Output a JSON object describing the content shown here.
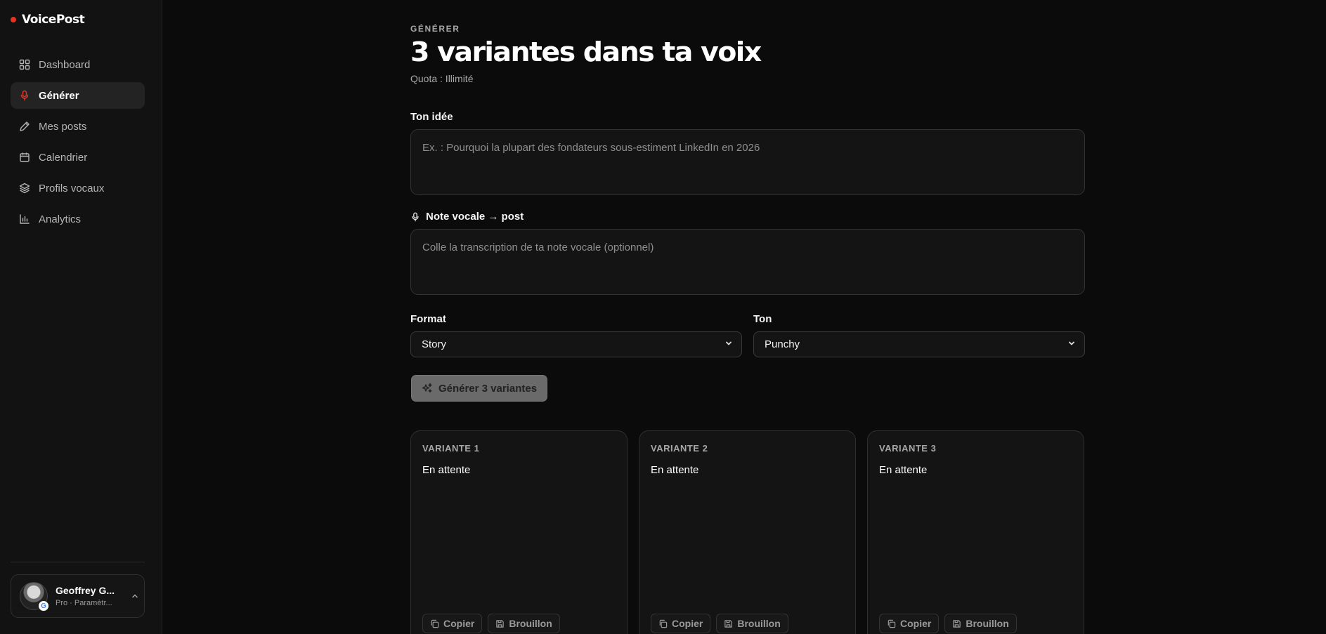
{
  "app": {
    "name": "VoicePost",
    "accent": "#e53421"
  },
  "sidebar": {
    "items": [
      {
        "label": "Dashboard",
        "icon": "grid-icon"
      },
      {
        "label": "Générer",
        "icon": "microphone-icon",
        "active": true
      },
      {
        "label": "Mes posts",
        "icon": "pen-icon"
      },
      {
        "label": "Calendrier",
        "icon": "calendar-icon"
      },
      {
        "label": "Profils vocaux",
        "icon": "layers-icon"
      },
      {
        "label": "Analytics",
        "icon": "bar-chart-icon"
      }
    ],
    "user": {
      "name": "Geoffrey G...",
      "subtitle": "Pro · Paramètr...",
      "badge": "G"
    }
  },
  "main": {
    "eyebrow": "GÉNÉRER",
    "title": "3 variantes dans ta voix",
    "quota": "Quota : Illimité",
    "idea": {
      "label": "Ton idée",
      "placeholder": "Ex. : Pourquoi la plupart des fondateurs sous-estiment LinkedIn en 2026",
      "value": ""
    },
    "voice_note": {
      "label": "Note vocale → post",
      "placeholder": "Colle la transcription de ta note vocale (optionnel)",
      "value": ""
    },
    "format": {
      "label": "Format",
      "value": "Story"
    },
    "tone": {
      "label": "Ton",
      "value": "Punchy"
    },
    "generate_button": "Générer 3 variantes",
    "variants": [
      {
        "label": "VARIANTE 1",
        "status": "En attente",
        "copy": "Copier",
        "draft": "Brouillon"
      },
      {
        "label": "VARIANTE 2",
        "status": "En attente",
        "copy": "Copier",
        "draft": "Brouillon"
      },
      {
        "label": "VARIANTE 3",
        "status": "En attente",
        "copy": "Copier",
        "draft": "Brouillon"
      }
    ]
  }
}
